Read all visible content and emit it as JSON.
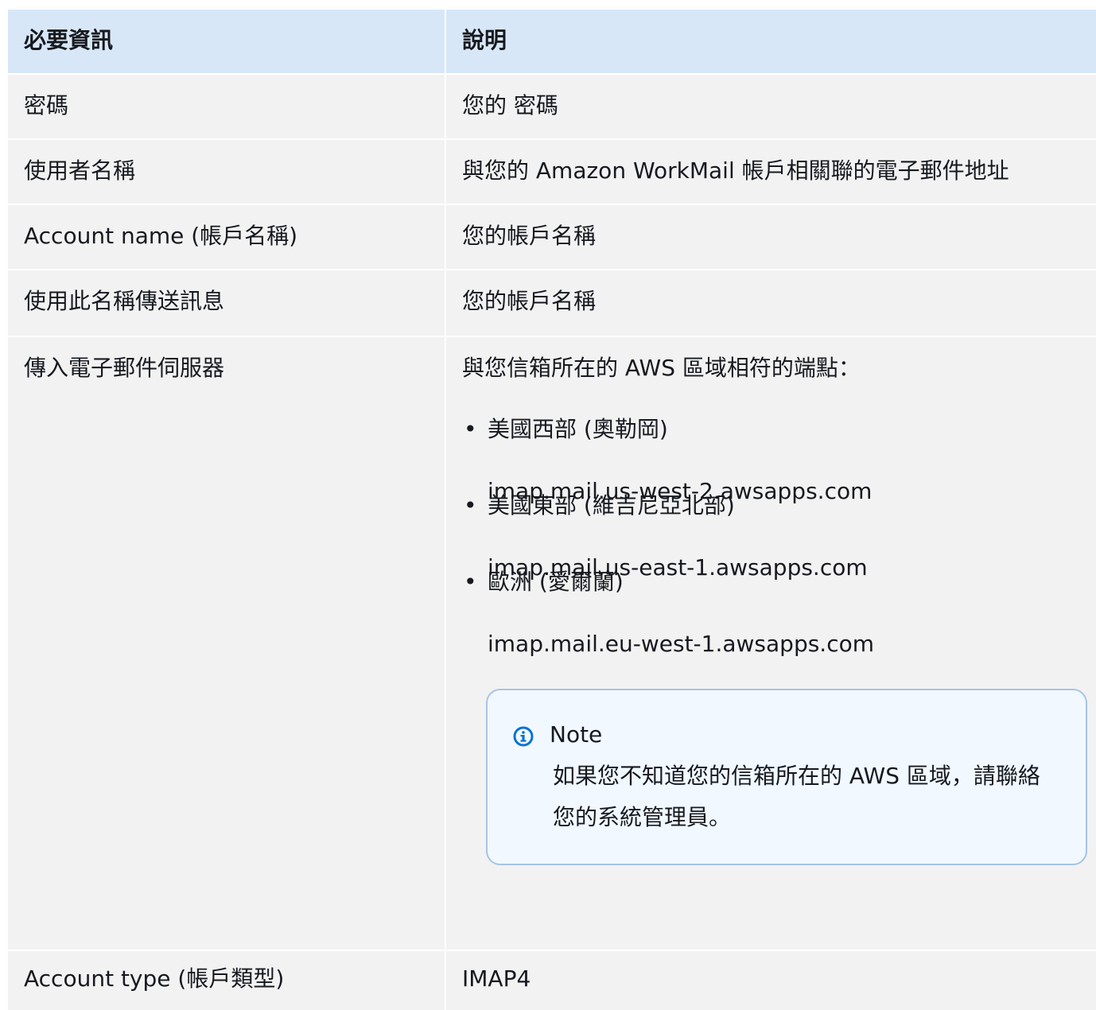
{
  "table": {
    "headers": [
      "必要資訊",
      "說明"
    ],
    "rows": [
      {
        "label": "密碼",
        "value": "您的 密碼"
      },
      {
        "label": "使用者名稱",
        "value": "與您的 Amazon WorkMail 帳戶相關聯的電子郵件地址"
      },
      {
        "label": "Account name (帳戶名稱)",
        "value": "您的帳戶名稱"
      },
      {
        "label": "使用此名稱傳送訊息",
        "value": "您的帳戶名稱"
      },
      {
        "label": "傳入電子郵件伺服器",
        "value": "與您信箱所在的 AWS 區域相符的端點："
      },
      {
        "label": "Account type (帳戶類型)",
        "value": "IMAP4"
      }
    ],
    "regions": [
      {
        "bullet": "•",
        "name": "美國西部 (奧勒岡)",
        "endpoint": "imap.mail.us-west-2.awsapps.com"
      },
      {
        "bullet": "•",
        "name": "美國東部 (維吉尼亞北部)",
        "endpoint": "imap.mail.us-east-1.awsapps.com"
      },
      {
        "bullet": "•",
        "name": "歐洲 (愛爾蘭)",
        "endpoint": "imap.mail.eu-west-1.awsapps.com"
      }
    ],
    "note": {
      "icon": "info-icon",
      "title": "Note",
      "body": "如果您不知道您的信箱所在的 AWS 區域，請聯絡您的系統管理員。"
    }
  },
  "colors": {
    "header_bg": "#d8e7f7",
    "row_bg": "#f2f2f2",
    "note_bg": "#f1f8ff",
    "note_border": "#a7c4e5",
    "info_icon": "#0972d3"
  }
}
